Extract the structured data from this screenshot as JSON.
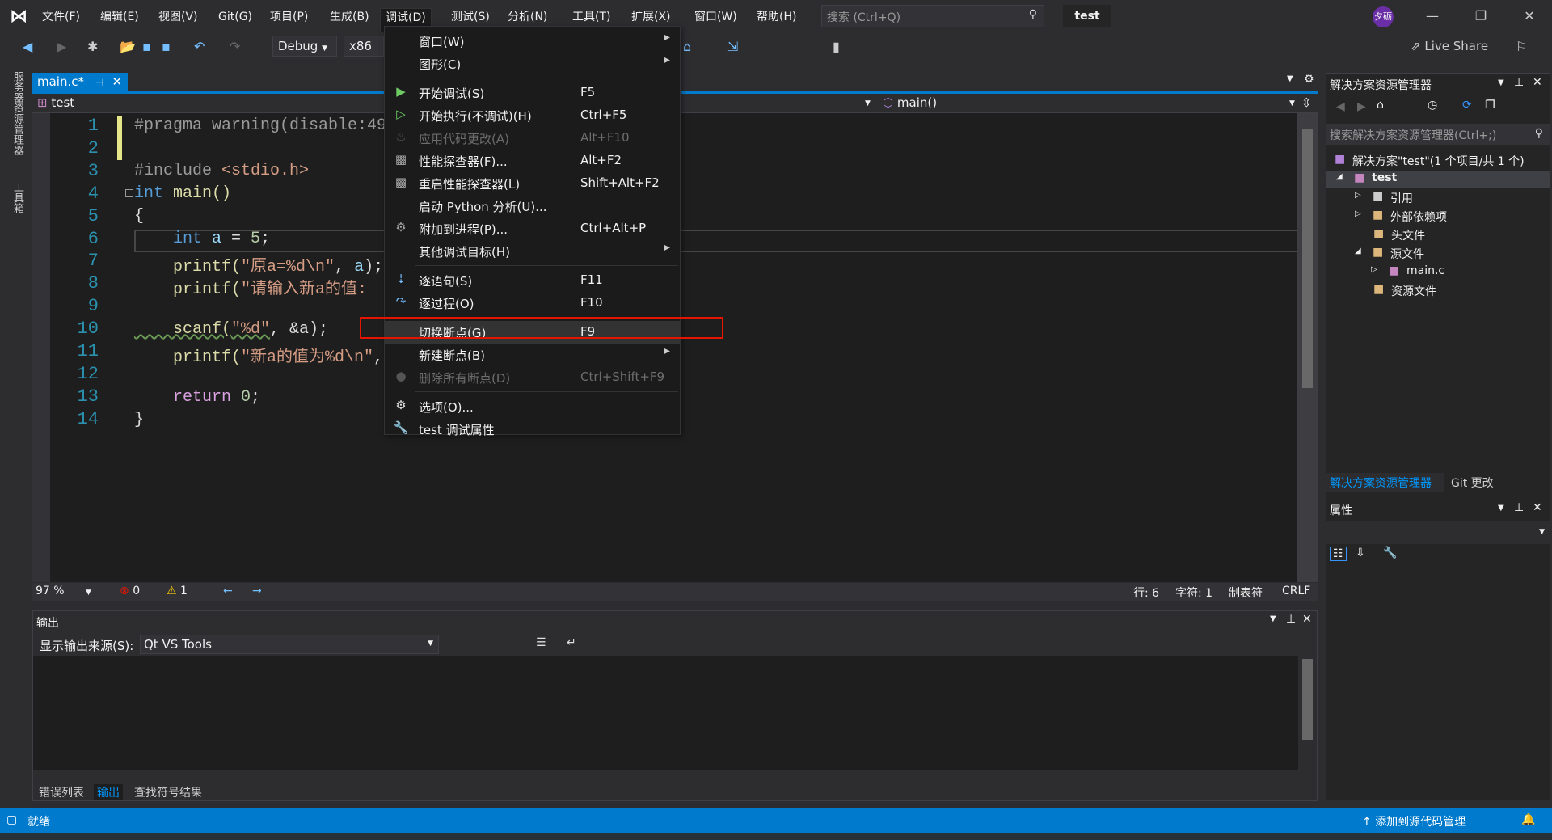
{
  "menubar": {
    "items": [
      "文件(F)",
      "编辑(E)",
      "视图(V)",
      "Git(G)",
      "项目(P)",
      "生成(B)",
      "调试(D)",
      "测试(S)",
      "分析(N)",
      "工具(T)",
      "扩展(X)",
      "窗口(W)",
      "帮助(H)"
    ],
    "search_placeholder": "搜索 (Ctrl+Q)",
    "project": "test",
    "avatar": "夕砺"
  },
  "toolbar": {
    "config": "Debug",
    "platform": "x86",
    "live_share": "Live Share"
  },
  "sidestrip": [
    "服务器资源管理器",
    "工具箱"
  ],
  "editor": {
    "tab": "main.c*",
    "nav_project": "test",
    "nav_function": "main()",
    "lines": [
      "1",
      "2",
      "3",
      "4",
      "5",
      "6",
      "7",
      "8",
      "9",
      "10",
      "11",
      "12",
      "13",
      "14"
    ],
    "code": {
      "l1": "#pragma warning(disable:499",
      "l3a": "#include ",
      "l3b": "<stdio.h>",
      "l4a": "int ",
      "l4b": "main()",
      "l5": "{",
      "l6a": "    int ",
      "l6b": "a",
      "l6d": " = ",
      "l6e": "5",
      "l6f": ";",
      "l7a": "    printf(",
      "l7b": "\"原a=%d\\n\"",
      "l7c": ", ",
      "l7d": "a",
      "l7e": ");",
      "l8a": "    printf(",
      "l8b": "\"请输入新a的值:",
      "l10a": "    scanf(",
      "l10b": "\"%d\"",
      "l10c": ", &a);",
      "l11a": "    printf(",
      "l11b": "\"新a的值为%d\\n\"",
      "l11c": ",",
      "l13a": "    return ",
      "l13b": "0",
      "l13c": ";",
      "l14": "}"
    },
    "zoom": "97 %",
    "errors": "0",
    "warnings": "1",
    "row": "行: 6",
    "col": "字符: 1",
    "tabs": "制表符",
    "eol": "CRLF"
  },
  "output": {
    "title": "输出",
    "source_label": "显示输出来源(S):",
    "source_value": "Qt VS Tools",
    "tabs": [
      "错误列表",
      "输出",
      "查找符号结果"
    ]
  },
  "solution": {
    "title": "解决方案资源管理器",
    "search_placeholder": "搜索解决方案资源管理器(Ctrl+;)",
    "tree": [
      "解决方案\"test\"(1 个项目/共 1 个)",
      "test",
      "引用",
      "外部依赖项",
      "头文件",
      "源文件",
      "main.c",
      "资源文件"
    ],
    "tabs": [
      "解决方案资源管理器",
      "Git 更改"
    ]
  },
  "properties": {
    "title": "属性"
  },
  "statusbar": {
    "ready": "就绪",
    "source_control": "添加到源代码管理"
  },
  "debug_menu": {
    "items": [
      {
        "label": "窗口(W)",
        "shortcut": "",
        "sub": true,
        "icon": ""
      },
      {
        "label": "图形(C)",
        "shortcut": "",
        "sub": true,
        "icon": ""
      },
      {
        "sep": true
      },
      {
        "label": "开始调试(S)",
        "shortcut": "F5",
        "icon": "play-icon"
      },
      {
        "label": "开始执行(不调试)(H)",
        "shortcut": "Ctrl+F5",
        "icon": "play-outline-icon"
      },
      {
        "label": "应用代码更改(A)",
        "shortcut": "Alt+F10",
        "icon": "flame-icon",
        "disabled": true
      },
      {
        "label": "性能探查器(F)...",
        "shortcut": "Alt+F2",
        "icon": "chart-icon"
      },
      {
        "label": "重启性能探查器(L)",
        "shortcut": "Shift+Alt+F2",
        "icon": "chart-icon"
      },
      {
        "label": "启动 Python 分析(U)...",
        "shortcut": "",
        "icon": ""
      },
      {
        "label": "附加到进程(P)...",
        "shortcut": "Ctrl+Alt+P",
        "icon": "gears-icon"
      },
      {
        "label": "其他调试目标(H)",
        "shortcut": "",
        "sub": true,
        "icon": ""
      },
      {
        "sep": true
      },
      {
        "label": "逐语句(S)",
        "shortcut": "F11",
        "icon": "step-into-icon"
      },
      {
        "label": "逐过程(O)",
        "shortcut": "F10",
        "icon": "step-over-icon"
      },
      {
        "sep": true
      },
      {
        "label": "切换断点(G)",
        "shortcut": "F9",
        "icon": "",
        "highlighted": true
      },
      {
        "label": "新建断点(B)",
        "shortcut": "",
        "sub": true,
        "icon": ""
      },
      {
        "label": "删除所有断点(D)",
        "shortcut": "Ctrl+Shift+F9",
        "icon": "delete-breakpoints-icon",
        "disabled": true
      },
      {
        "sep": true
      },
      {
        "label": "选项(O)...",
        "shortcut": "",
        "icon": "gear-icon"
      },
      {
        "label": "test 调试属性",
        "shortcut": "",
        "icon": "wrench-icon"
      }
    ]
  },
  "colors": {
    "accent": "#007acc",
    "highlight_box": "#e51400"
  }
}
